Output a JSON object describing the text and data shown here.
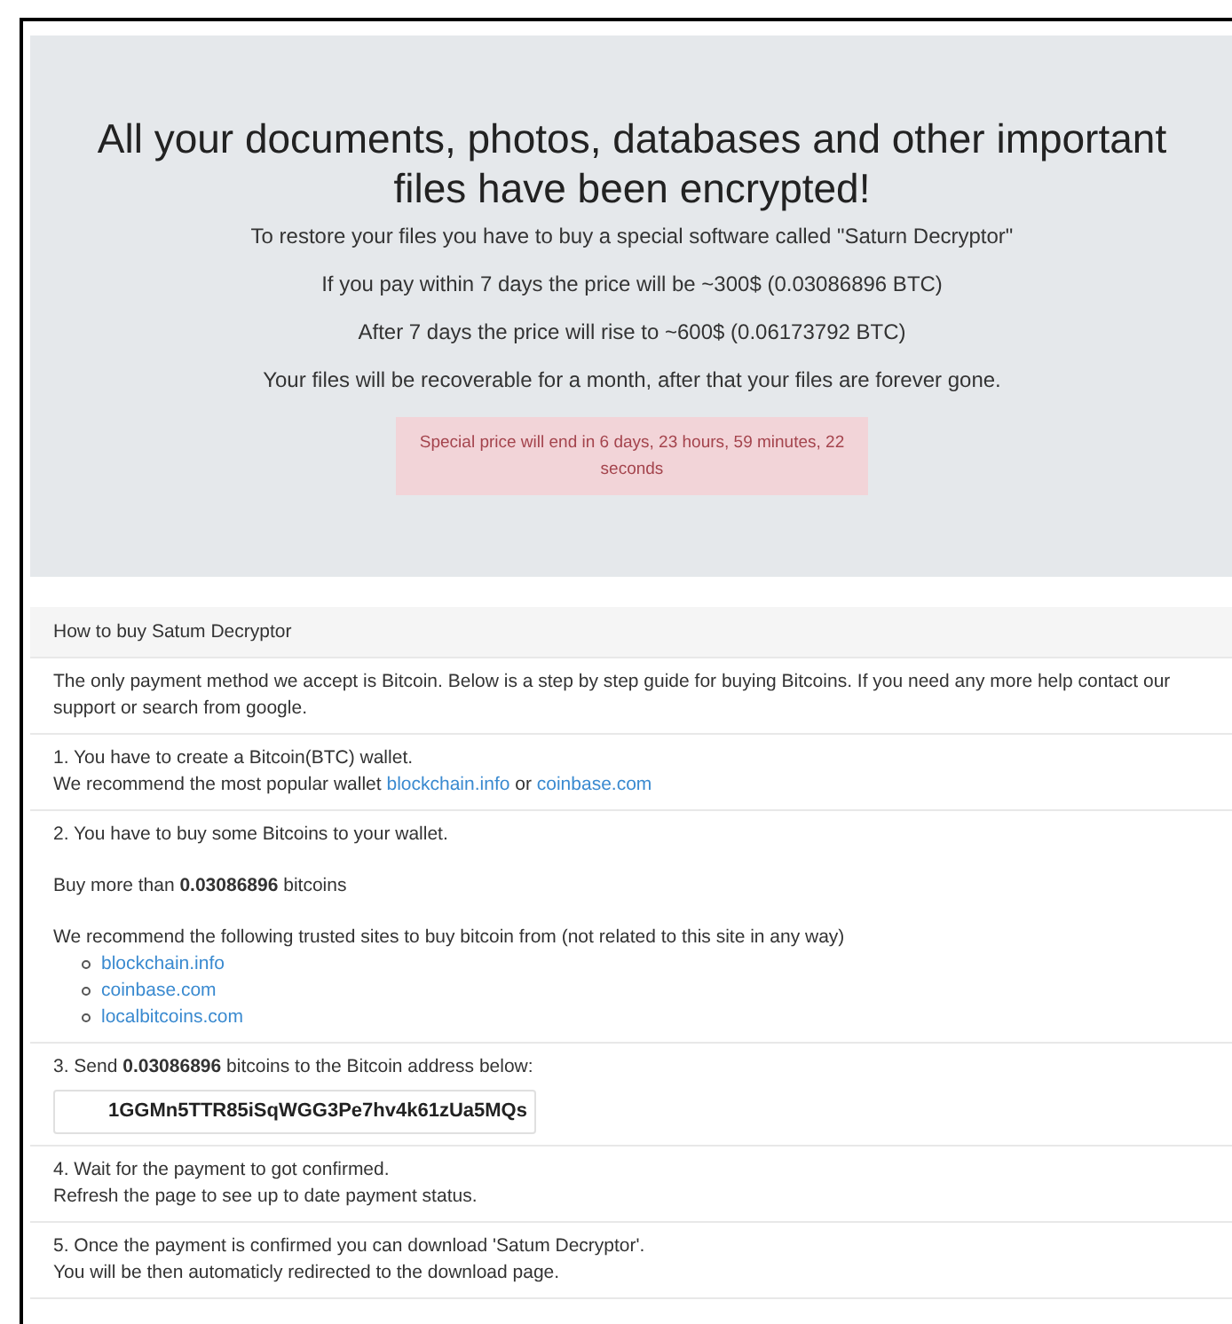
{
  "hero": {
    "heading": "All your documents, photos, databases and other important files have been encrypted!",
    "lines": [
      "To restore your files you have to buy a special software called \"Saturn Decryptor\"",
      "If you pay within 7 days the price will be ~300$ (0.03086896 BTC)",
      "After 7 days the price will rise to ~600$ (0.06173792 BTC)",
      "Your files will be recoverable for a month, after that your files are forever gone."
    ],
    "countdown": "Special price will end in 6 days, 23 hours, 59 minutes, 22 seconds"
  },
  "guide": {
    "title": "How to buy Satum Decryptor",
    "steps": [
      {
        "blocks": [
          {
            "kind": "para",
            "lines": [
              [
                {
                  "text": "The only payment method we accept is Bitcoin. Below is a step by step guide for buying Bitcoins. If you need any more help contact our support or search from google."
                }
              ]
            ]
          }
        ]
      },
      {
        "blocks": [
          {
            "kind": "para",
            "lines": [
              [
                {
                  "text": "1. You have to create a Bitcoin(BTC) wallet."
                }
              ],
              [
                {
                  "text": "We recommend the most popular wallet "
                },
                {
                  "link": "blockchain.info"
                },
                {
                  "text": " or "
                },
                {
                  "link": "coinbase.com"
                }
              ]
            ]
          }
        ]
      },
      {
        "blocks": [
          {
            "kind": "para",
            "lines": [
              [
                {
                  "text": "2. You have to buy some Bitcoins to your wallet."
                }
              ]
            ]
          },
          {
            "kind": "para",
            "lines": [
              [
                {
                  "text": "Buy more than **0.03086896** bitcoins"
                }
              ]
            ]
          },
          {
            "kind": "para",
            "lines": [
              [
                {
                  "text": "We recommend the following trusted sites to buy bitcoin from (not related to this site in any way)"
                }
              ]
            ]
          },
          {
            "kind": "list",
            "items": [
              "blockchain.info",
              "coinbase.com",
              "localbitcoins.com"
            ]
          }
        ]
      },
      {
        "blocks": [
          {
            "kind": "para",
            "lines": [
              [
                {
                  "text": "3. Send **0.03086896** bitcoins to the Bitcoin address below:"
                }
              ]
            ]
          },
          {
            "kind": "address",
            "value": "1GGMn5TTR85iSqWGG3Pe7hv4k61zUa5MQs"
          }
        ]
      },
      {
        "blocks": [
          {
            "kind": "para",
            "lines": [
              [
                {
                  "text": "4. Wait for the payment to got confirmed."
                }
              ],
              [
                {
                  "text": "Refresh the page to see up to date payment status."
                }
              ]
            ]
          }
        ]
      },
      {
        "blocks": [
          {
            "kind": "para",
            "lines": [
              [
                {
                  "text": "5. Once the payment is confirmed you can download 'Satum Decryptor'."
                }
              ],
              [
                {
                  "text": "You will be then automaticly redirected to the download page."
                }
              ]
            ]
          }
        ]
      }
    ]
  }
}
